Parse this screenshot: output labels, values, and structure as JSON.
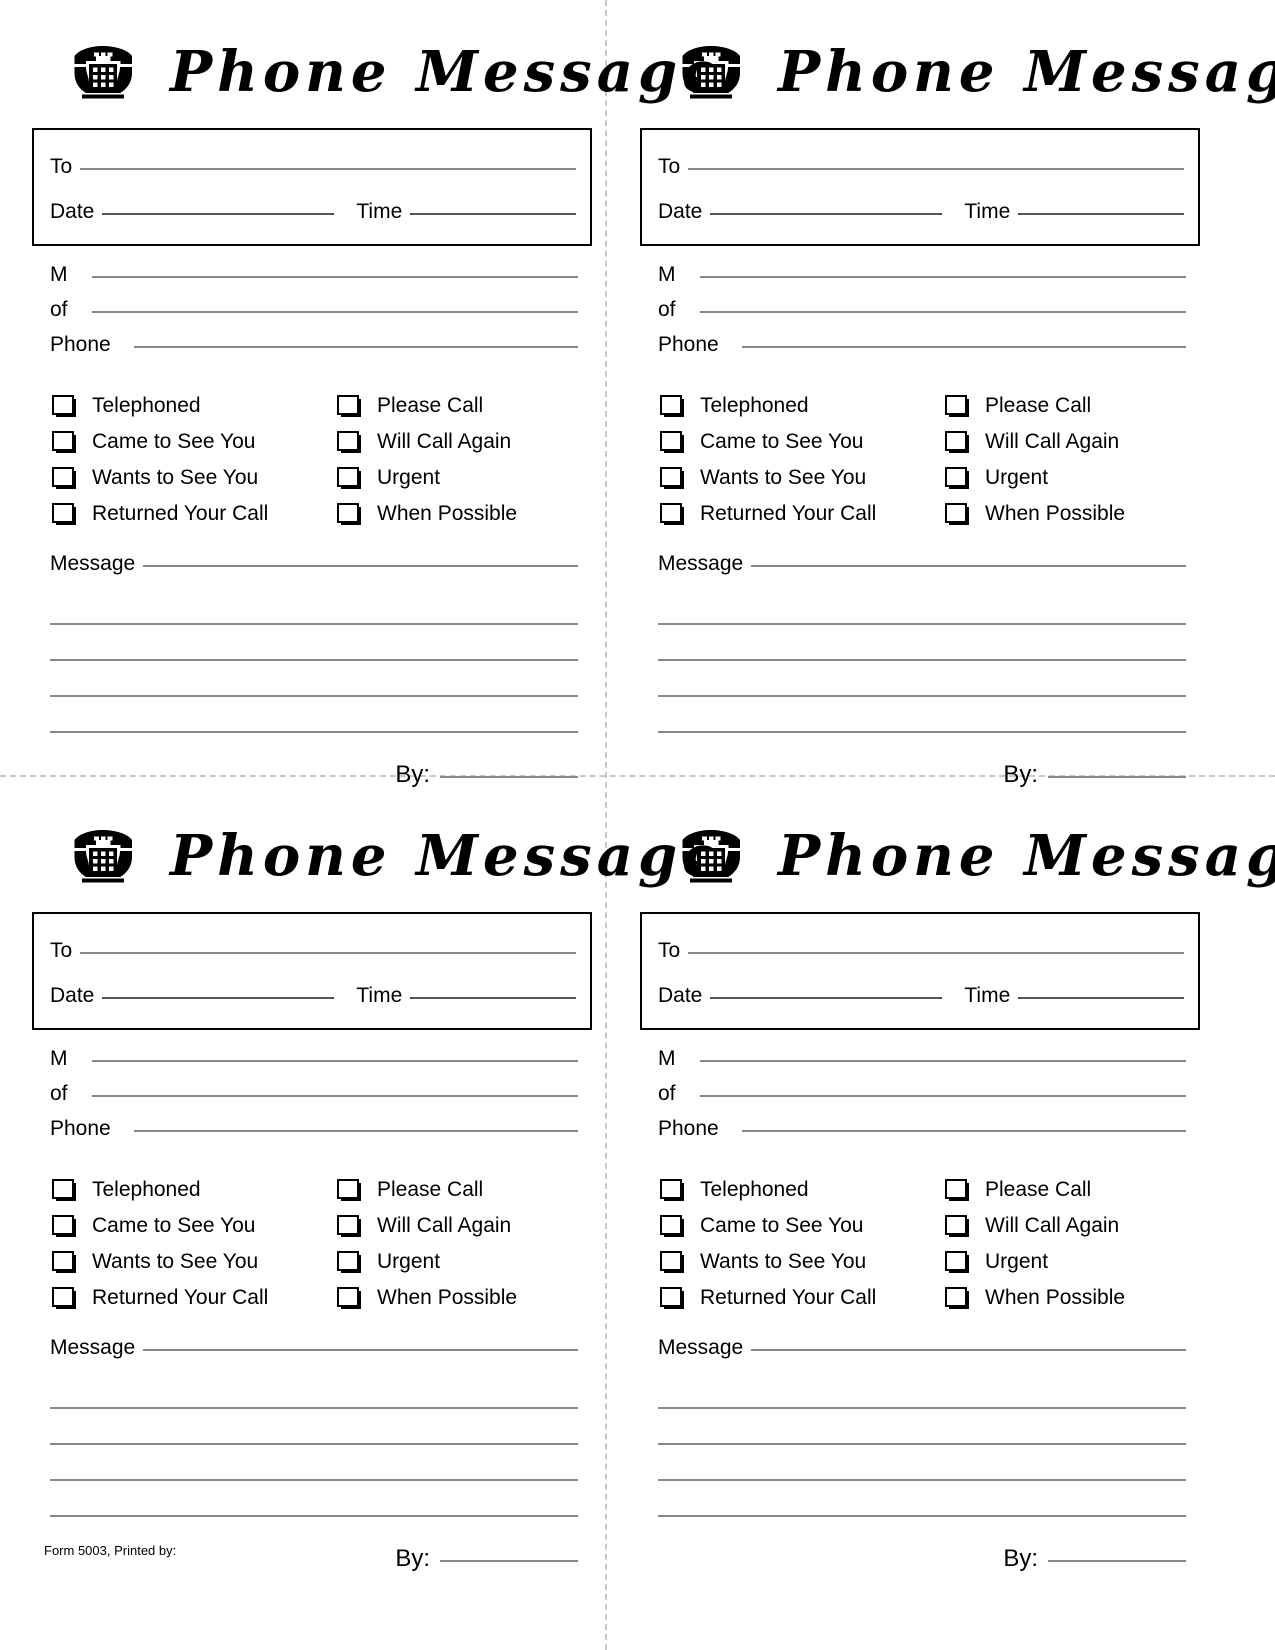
{
  "document": {
    "title": "Phone Message",
    "icon": "telephone-icon",
    "footer_note": "Form 5003, Printed by:",
    "cut_line_color": "#c8c8c8",
    "rule_color": "#888888",
    "border_color": "#000000"
  },
  "slip": {
    "header": {
      "title": "Phone Message",
      "icon_name": "telephone-icon"
    },
    "top_box": {
      "to_label": "To",
      "date_label": "Date",
      "time_label": "Time",
      "to_value": "",
      "date_value": "",
      "time_value": ""
    },
    "caller": {
      "m_label": "M",
      "of_label": "of",
      "phone_label": "Phone",
      "m_value": "",
      "of_value": "",
      "phone_value": ""
    },
    "checkboxes": {
      "left_column": [
        {
          "label": "Telephoned",
          "checked": false
        },
        {
          "label": "Came to See You",
          "checked": false
        },
        {
          "label": "Wants to See You",
          "checked": false
        },
        {
          "label": "Returned Your Call",
          "checked": false
        }
      ],
      "right_column": [
        {
          "label": "Please Call",
          "checked": false
        },
        {
          "label": "Will Call Again",
          "checked": false
        },
        {
          "label": "Urgent",
          "checked": false
        },
        {
          "label": "When Possible",
          "checked": false
        }
      ]
    },
    "message": {
      "label": "Message",
      "value": "",
      "line_count": 5
    },
    "signature": {
      "by_label": "By:",
      "by_value": ""
    }
  },
  "slips": [
    {
      "position": "top-left"
    },
    {
      "position": "top-right"
    },
    {
      "position": "bottom-left"
    },
    {
      "position": "bottom-right"
    }
  ]
}
